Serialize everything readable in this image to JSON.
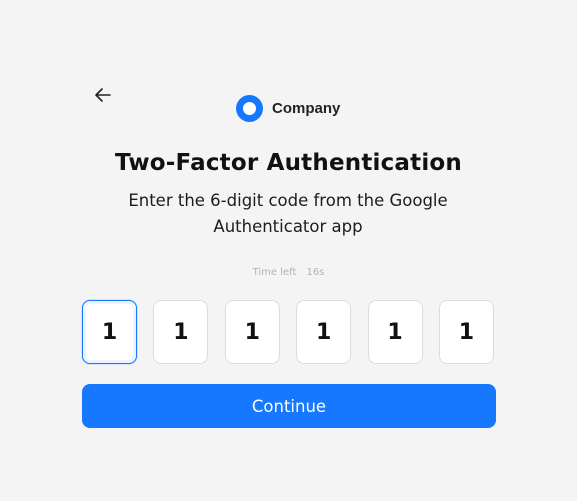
{
  "brand": {
    "name": "Company",
    "accent": "#1677ff"
  },
  "header": {
    "back_icon": "arrow-left-icon"
  },
  "main": {
    "title": "Two-Factor Authentication",
    "subtitle": "Enter the 6-digit code from the Google Authenticator app",
    "timer_label": "Time left",
    "timer_value": "16s"
  },
  "otp": {
    "digits": [
      "1",
      "1",
      "1",
      "1",
      "1",
      "1"
    ],
    "active_index": 0
  },
  "actions": {
    "continue_label": "Continue"
  }
}
